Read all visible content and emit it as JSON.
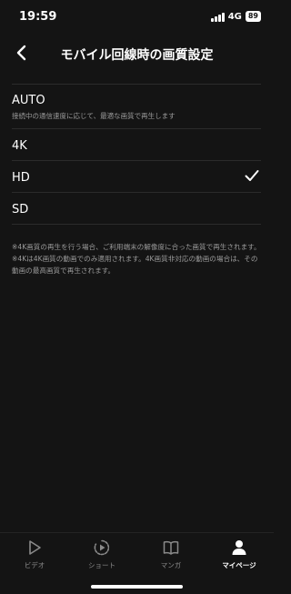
{
  "status": {
    "time": "19:59",
    "network": "4G",
    "battery": "89"
  },
  "header": {
    "title": "モバイル回線時の画質設定"
  },
  "options": [
    {
      "label": "AUTO",
      "description": "接続中の通信速度に応じて、最適な画質で再生します",
      "selected": false
    },
    {
      "label": "4K",
      "selected": false
    },
    {
      "label": "HD",
      "selected": true
    },
    {
      "label": "SD",
      "selected": false
    }
  ],
  "notes": [
    "※4K画質の再生を行う場合、ご利用端末の解像度に合った画質で再生されます。",
    "※4Kは4K画質の動画でのみ適用されます。4K画質非対応の動画の場合は、その動画の最高画質で再生されます。"
  ],
  "tabs": [
    {
      "label": "ビデオ",
      "icon": "play-icon"
    },
    {
      "label": "ショート",
      "icon": "short-icon"
    },
    {
      "label": "マンガ",
      "icon": "book-icon"
    },
    {
      "label": "マイページ",
      "icon": "person-icon",
      "active": true
    }
  ],
  "colors": {
    "background": "#141414",
    "divider": "#2b2b2b",
    "text_secondary": "#9a9a9a"
  }
}
